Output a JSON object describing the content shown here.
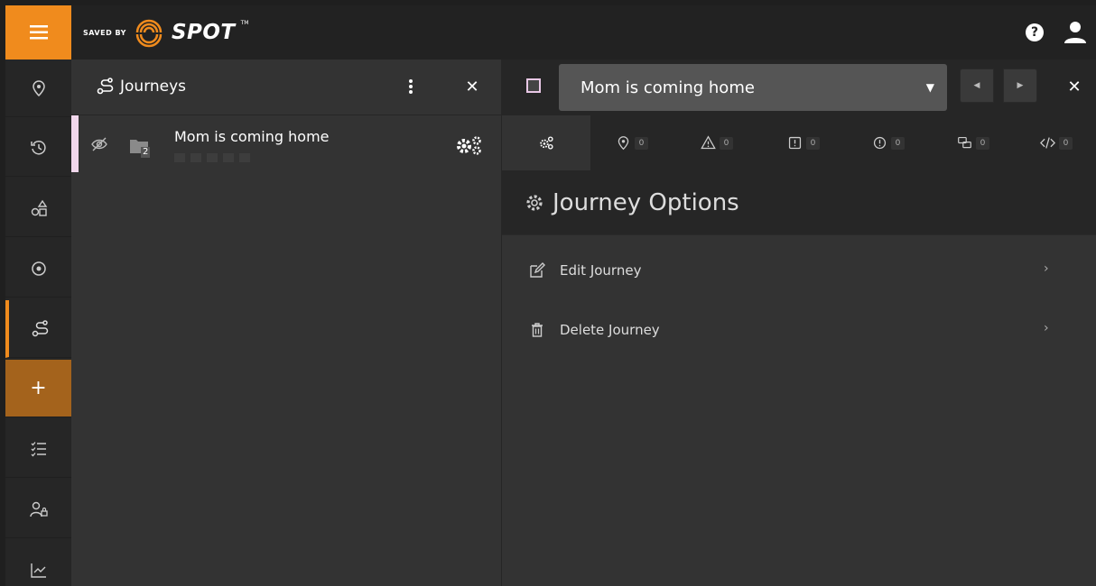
{
  "brand": {
    "logo_small": "SAVED BY",
    "logo_main": "SPOT",
    "logo_tm": "TM",
    "accent_color": "#f08b1d"
  },
  "topbar": {
    "help_label": "?"
  },
  "rail": {
    "items": [
      {
        "icon": "location-pin-icon"
      },
      {
        "icon": "history-icon"
      },
      {
        "icon": "shapes-icon"
      },
      {
        "icon": "target-icon"
      },
      {
        "icon": "journey-route-icon",
        "active": true
      },
      {
        "icon": "plus-icon",
        "label": "+"
      },
      {
        "icon": "checklist-icon"
      },
      {
        "icon": "user-lock-icon"
      },
      {
        "icon": "chart-icon"
      }
    ]
  },
  "journeys": {
    "title": "Journeys",
    "kebab": "⋮",
    "close": "✕",
    "list": [
      {
        "name": "Mom is coming home",
        "badge": "2",
        "accent": "#f2d7ec"
      }
    ]
  },
  "detail": {
    "selected_journey": "Mom is coming home",
    "caret": "▼",
    "prev": "◀",
    "next": "▶",
    "close": "✕",
    "tabs": [
      {
        "icon": "gears-icon",
        "count": ""
      },
      {
        "icon": "location-pin-icon",
        "count": "0"
      },
      {
        "icon": "warning-triangle-icon",
        "count": "0"
      },
      {
        "icon": "alert-square-icon",
        "count": "0"
      },
      {
        "icon": "alert-circle-icon",
        "count": "0"
      },
      {
        "icon": "chat-bubbles-icon",
        "count": "0"
      },
      {
        "icon": "code-icon",
        "count": "0"
      }
    ],
    "section_title": "Journey Options",
    "options": [
      {
        "label": "Edit Journey",
        "icon": "edit-icon",
        "chevron": "›"
      },
      {
        "label": "Delete Journey",
        "icon": "trash-icon",
        "chevron": "›"
      }
    ]
  }
}
